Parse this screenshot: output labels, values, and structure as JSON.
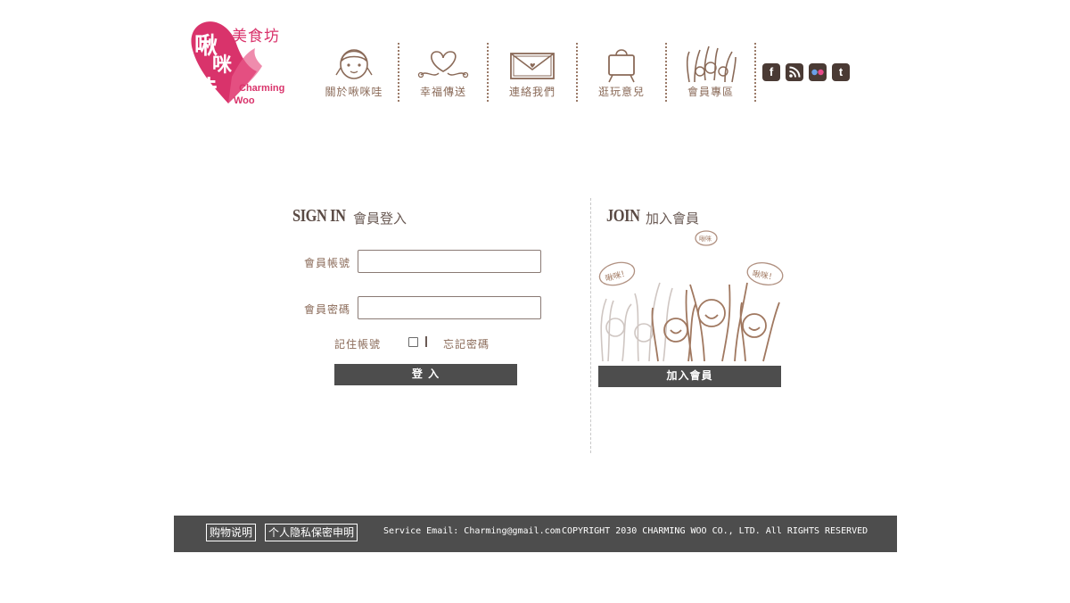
{
  "brand": {
    "name_cn": "美食坊",
    "name_en_line1": "Charming",
    "name_en_line2": "Woo",
    "accent_color": "#d9336b"
  },
  "nav": {
    "items": [
      {
        "label": "關於啾咪哇",
        "icon": "girl-face-icon"
      },
      {
        "label": "幸福傳送",
        "icon": "heart-string-icon"
      },
      {
        "label": "連絡我們",
        "icon": "envelope-icon"
      },
      {
        "label": "逛玩意兒",
        "icon": "shopping-bag-icon"
      },
      {
        "label": "會員專區",
        "icon": "raised-hands-icon"
      }
    ]
  },
  "social": {
    "items": [
      {
        "label": "f",
        "icon": "facebook-icon"
      },
      {
        "label": "",
        "icon": "rss-icon"
      },
      {
        "label": "",
        "icon": "flickr-icon"
      },
      {
        "label": "t",
        "icon": "twitter-icon"
      }
    ]
  },
  "signin": {
    "title_en": "SIGN IN",
    "title_cn": "會員登入",
    "account_label": "會員帳號",
    "account_value": "",
    "password_label": "會員密碼",
    "password_value": "",
    "remember_label": "記住帳號",
    "remember_checked": false,
    "forgot_label": "忘記密碼",
    "submit_label": "登 入"
  },
  "join": {
    "title_en": "JOIN",
    "title_cn": "加入會員",
    "bubble_1": "啾咪",
    "bubble_2": "啾咪！",
    "bubble_3": "啾咪！",
    "button_label": "加入會員"
  },
  "footer": {
    "shopping_guide": "购物说明",
    "privacy": "个人隐私保密申明",
    "service_email": "Service Email: Charming@gmail.com",
    "copyright": "COPYRIGHT 2030 CHARMING WOO CO., LTD. All RIGHTS RESERVED",
    "background_color": "#4d4d4d"
  }
}
